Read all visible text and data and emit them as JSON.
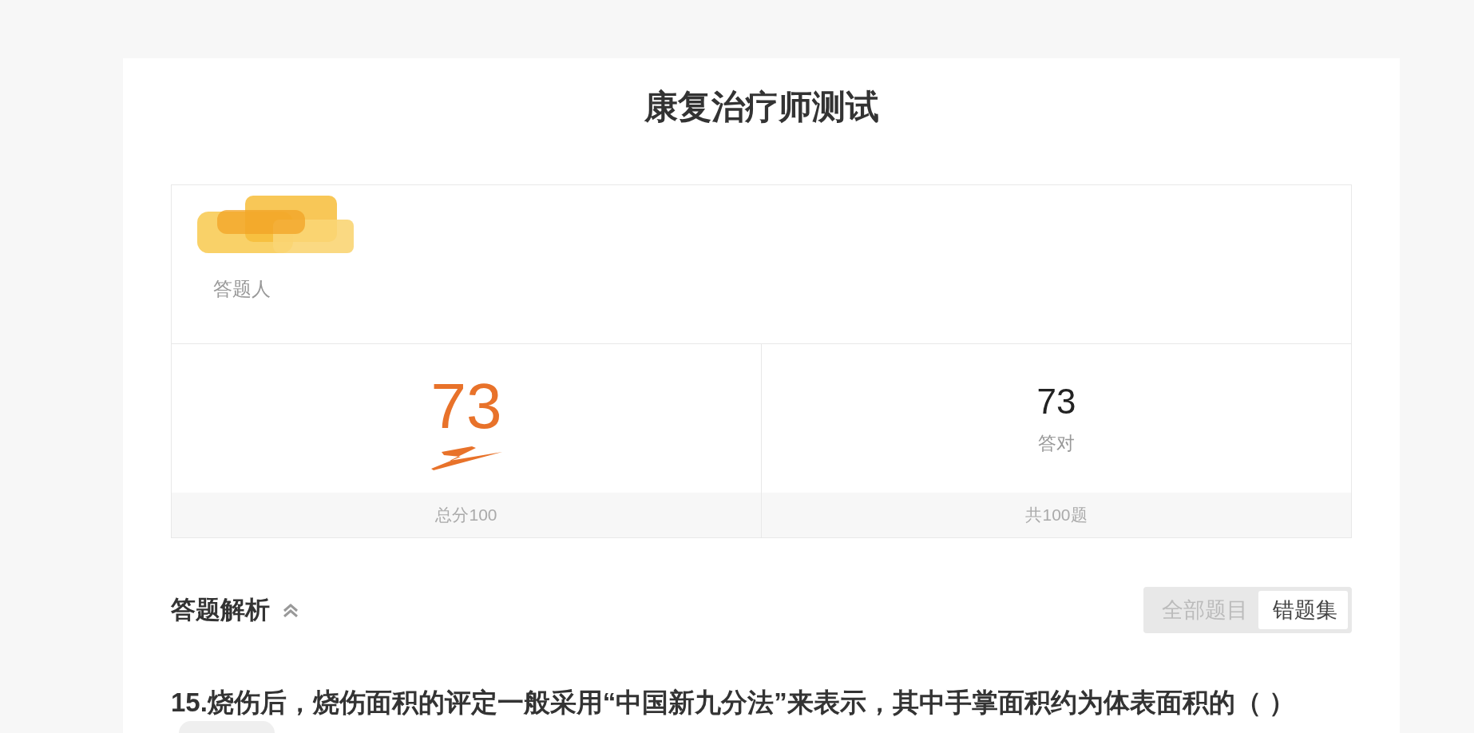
{
  "page": {
    "title": "康复治疗师测试"
  },
  "respondent": {
    "name_hidden": true,
    "label": "答题人"
  },
  "stats": [
    {
      "kind": "score",
      "value": "73",
      "footer": "总分100"
    },
    {
      "kind": "count",
      "value": "73",
      "label": "答对",
      "footer": "共100题"
    }
  ],
  "analysis": {
    "title": "答题解析",
    "expanded": true,
    "filters": [
      {
        "label": "全部题目",
        "selected": false
      },
      {
        "label": "错题集",
        "selected": true
      }
    ]
  },
  "questions": [
    {
      "text": "15.烧伤后，烧伤面积的评定一般采用“中国新九分法”来表示，其中手掌面积约为体表面积的（ ）",
      "has_tag": true
    }
  ]
}
